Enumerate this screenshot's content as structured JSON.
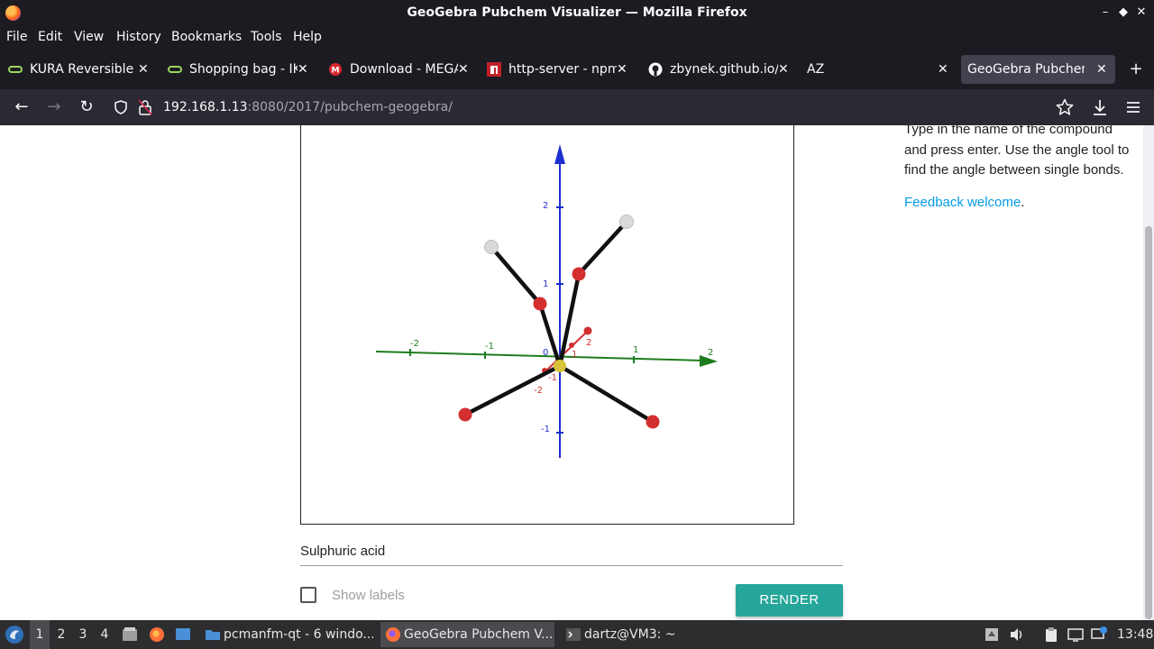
{
  "window": {
    "title": "GeoGebra Pubchem Visualizer — Mozilla Firefox"
  },
  "menu": [
    "File",
    "Edit",
    "View",
    "History",
    "Bookmarks",
    "Tools",
    "Help"
  ],
  "tabs": [
    {
      "label": "KURA Reversible b",
      "icon": "link-icon"
    },
    {
      "label": "Shopping bag - IKI",
      "icon": "link-icon"
    },
    {
      "label": "Download - MEGA",
      "icon": "mega-icon"
    },
    {
      "label": "http-server - npm",
      "icon": "npm-icon"
    },
    {
      "label": "zbynek.github.io/i",
      "icon": "github-icon"
    },
    {
      "label": "AZ",
      "icon": ""
    },
    {
      "label": "GeoGebra Pubchem V",
      "icon": "",
      "active": true
    }
  ],
  "url": {
    "host": "192.168.1.13",
    "rest": ":8080/2017/pubchem-geogebra/"
  },
  "page": {
    "instructions": "Type in the name of the compound and press enter. Use the angle tool to find the angle between single bonds.",
    "feedback_link": "Feedback welcome",
    "feedback_suffix": ".",
    "compound_value": "Sulphuric acid",
    "show_labels": "Show labels",
    "show_labels_checked": false,
    "render_button": "RENDER"
  },
  "graph": {
    "axis_ticks": {
      "z": [
        "2",
        "1",
        "-1"
      ],
      "x": [
        "-2",
        "-1",
        "0",
        "1",
        "2"
      ],
      "y": [
        "2",
        "1",
        "-1",
        "-2"
      ]
    },
    "atoms": [
      {
        "element": "S",
        "color": "#d8c43a"
      },
      {
        "element": "O",
        "color": "#d32f2f"
      },
      {
        "element": "O",
        "color": "#d32f2f"
      },
      {
        "element": "O",
        "color": "#d32f2f"
      },
      {
        "element": "O",
        "color": "#d32f2f"
      },
      {
        "element": "H",
        "color": "#d9d9d9"
      },
      {
        "element": "H",
        "color": "#d9d9d9"
      }
    ]
  },
  "taskbar": {
    "workspaces": [
      "1",
      "2",
      "3",
      "4"
    ],
    "tasks": [
      {
        "label": "pcmanfm-qt - 6 windo...",
        "icon": "folder-icon"
      },
      {
        "label": "GeoGebra Pubchem V...",
        "icon": "firefox-icon",
        "active": true
      },
      {
        "label": "dartz@VM3: ~",
        "icon": "terminal-icon"
      }
    ],
    "clock": "13:48"
  },
  "colors": {
    "accent": "#26a69a",
    "link": "#039be5",
    "chrome_dark": "#1c1b22"
  }
}
